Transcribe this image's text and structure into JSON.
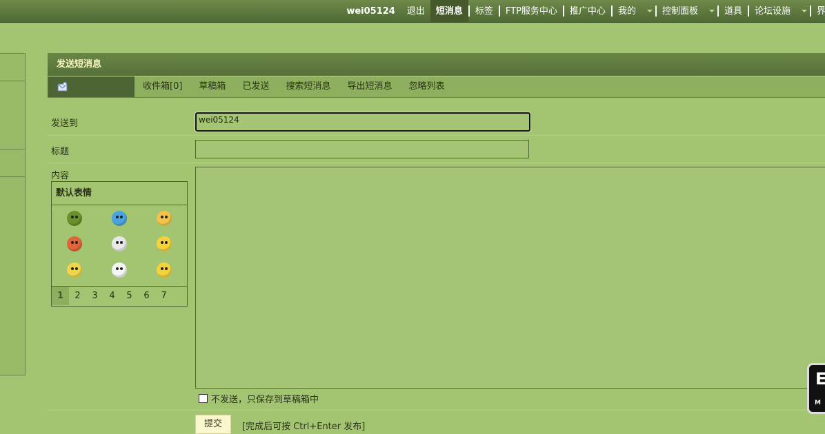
{
  "topbar": {
    "username": "wei05124",
    "logout": "退出",
    "messages": "短消息",
    "tags": "标签",
    "ftp": "FTP服务中心",
    "promo": "推广中心",
    "mine": "我的",
    "control_panel": "控制面板",
    "tools": "道具",
    "forum_settings": "论坛设施",
    "cut_item": "界"
  },
  "panel": {
    "title": "发送短消息",
    "compose_icon": "envelope-icon",
    "tabs": [
      "收件箱[0]",
      "草稿箱",
      "已发送",
      "搜索短消息",
      "导出短消息",
      "忽略列表"
    ]
  },
  "form": {
    "to_label": "发送到",
    "to_value": "wei05124",
    "subject_label": "标题",
    "subject_value": "",
    "content_label": "内容",
    "smiley_title": "默认表情",
    "smileys": [
      {
        "icon": "turtle-smiley-icon",
        "color": "#6b8f2a"
      },
      {
        "icon": "music-note-smiley-icon",
        "color": "#4aa3e0"
      },
      {
        "icon": "thumbs-up-smiley-icon",
        "color": "#f2c24a"
      },
      {
        "icon": "angry-face-smiley-icon",
        "color": "#e0663a"
      },
      {
        "icon": "skull-smiley-icon",
        "color": "#e8e8e8"
      },
      {
        "icon": "sunglasses-smiley-icon",
        "color": "#f5d23c"
      },
      {
        "icon": "grumpy-face-smiley-icon",
        "color": "#f0d44a"
      },
      {
        "icon": "soccer-ball-smiley-icon",
        "color": "#f4f4f4"
      },
      {
        "icon": "sleepy-face-smiley-icon",
        "color": "#f5d23c"
      }
    ],
    "pages": [
      "1",
      "2",
      "3",
      "4",
      "5",
      "6",
      "7"
    ],
    "current_page": "1",
    "draft_checkbox_label": "不发送，只保存到草稿箱中",
    "submit_label": "提交",
    "submit_hint": "[完成后可按 Ctrl+Enter 发布]"
  },
  "float_widget": {
    "big": "E",
    "small": "M"
  }
}
